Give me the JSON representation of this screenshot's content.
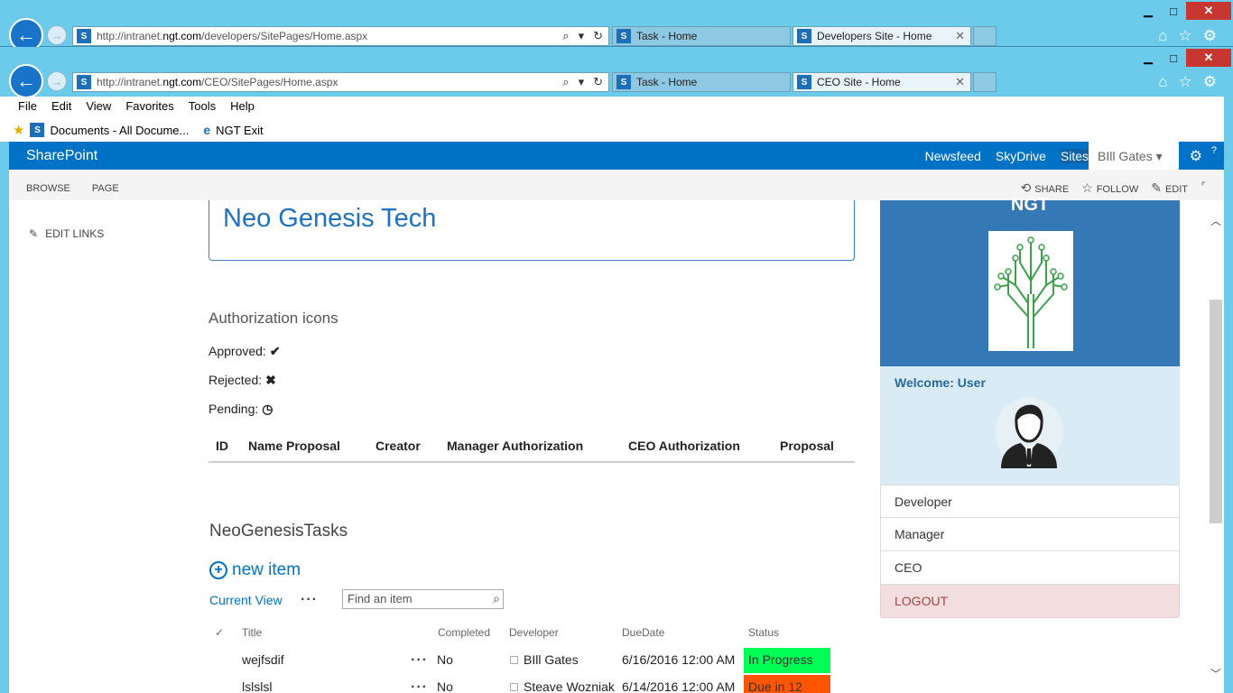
{
  "browser": {
    "back_window": {
      "url_plain": "http://intranet.",
      "url_domain": "ngt.com",
      "url_path": "/developers/SitePages/Home.aspx",
      "tabs": [
        {
          "label": "Task - Home"
        },
        {
          "label": "Developers Site - Home"
        }
      ]
    },
    "front_window": {
      "url_plain": "http://intranet.",
      "url_domain": "ngt.com",
      "url_path": "/CEO/SitePages/Home.aspx",
      "tabs": [
        {
          "label": "Task - Home"
        },
        {
          "label": "CEO Site - Home"
        }
      ]
    },
    "menus": [
      "File",
      "Edit",
      "View",
      "Favorites",
      "Tools",
      "Help"
    ],
    "favorites": [
      "Documents - All Docume...",
      "NGT Exit"
    ]
  },
  "suite": {
    "brand": "SharePoint",
    "links": [
      "Newsfeed",
      "SkyDrive",
      "Sites"
    ],
    "user": "BIll Gates"
  },
  "ribbon": {
    "tabs": [
      "BROWSE",
      "PAGE"
    ],
    "share": "SHARE",
    "follow": "FOLLOW",
    "edit": "EDIT"
  },
  "leftnav": {
    "edit_links": "EDIT LINKS"
  },
  "page": {
    "title": "Neo Genesis Tech",
    "auth_heading": "Authorization icons",
    "approved": "Approved:",
    "rejected": "Rejected:",
    "pending": "Pending:",
    "proposal_headers": [
      "ID",
      "Name Proposal",
      "Creator",
      "Manager Authorization",
      "CEO Authorization",
      "Proposal"
    ]
  },
  "tasks": {
    "heading": "NeoGenesisTasks",
    "new_item": "new item",
    "current_view": "Current View",
    "search_placeholder": "Find an item",
    "headers": {
      "check": "✓",
      "title": "Title",
      "completed": "Completed",
      "developer": "Developer",
      "due": "DueDate",
      "status": "Status"
    },
    "rows": [
      {
        "title": "wejfsdif",
        "completed": "No",
        "developer": "BIll Gates",
        "due": "6/16/2016 12:00 AM",
        "status": "In Progress",
        "status_color": "#00ff55"
      },
      {
        "title": "lslslsl",
        "completed": "No",
        "developer": "Steave Wozniak",
        "due": "6/14/2016 12:00 AM",
        "status": "Due in 12",
        "status_color": "#ff5500"
      }
    ]
  },
  "panel": {
    "name": "NGT",
    "welcome": "Welcome: User",
    "links": [
      "Developer",
      "Manager",
      "CEO"
    ],
    "logout": "LOGOUT"
  }
}
